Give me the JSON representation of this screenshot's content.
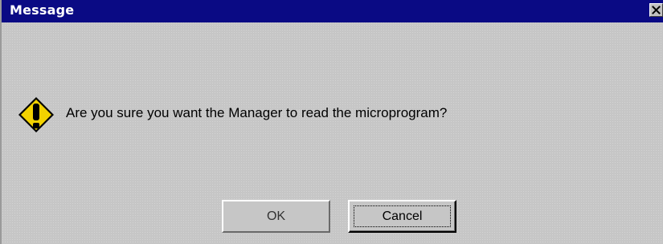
{
  "window": {
    "title": "Message",
    "close_glyph": "✕"
  },
  "dialog": {
    "icon": "warning-icon",
    "message": "Are you sure you want the Manager to read the microprogram?"
  },
  "buttons": {
    "ok_label": "OK",
    "cancel_label": "Cancel"
  },
  "colors": {
    "titlebar": "#0a0a84",
    "background": "#c6c6c6",
    "warning_fill": "#f0d000"
  }
}
